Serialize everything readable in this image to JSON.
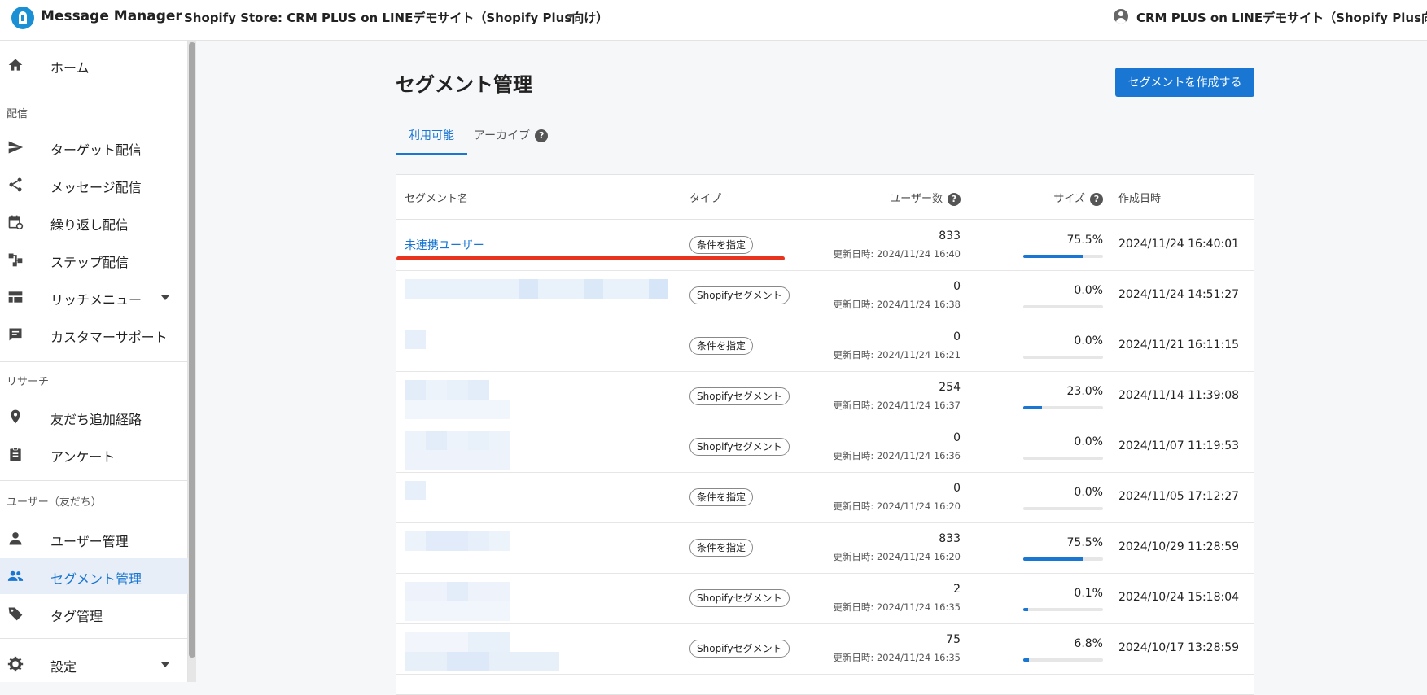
{
  "app": {
    "name": "Message Manager"
  },
  "header": {
    "store_label": "Shopify Store: CRM PLUS on LINEデモサイト（Shopify Plus向け）",
    "user_name": "CRM PLUS on LINEデモサイト（Shopify Plus向け）"
  },
  "sidebar": {
    "home": "ホーム",
    "section_delivery": "配信",
    "target_delivery": "ターゲット配信",
    "message_delivery": "メッセージ配信",
    "repeat_delivery": "繰り返し配信",
    "step_delivery": "ステップ配信",
    "rich_menu": "リッチメニュー",
    "customer_support": "カスタマーサポート",
    "section_research": "リサーチ",
    "friend_route": "友だち追加経路",
    "survey": "アンケート",
    "section_users": "ユーザー（友だち）",
    "user_management": "ユーザー管理",
    "segment_management": "セグメント管理",
    "tag_management": "タグ管理",
    "settings": "設定"
  },
  "main": {
    "title": "セグメント管理",
    "create_button": "セグメントを作成する",
    "tab_available": "利用可能",
    "tab_archive": "アーカイブ",
    "help_glyph": "?"
  },
  "table": {
    "headers": {
      "name": "セグメント名",
      "type": "タイプ",
      "users": "ユーザー数",
      "size": "サイズ",
      "created": "作成日時"
    },
    "rows": [
      {
        "name": "未連携ユーザー",
        "type": "条件を指定",
        "users": "833",
        "updated": "更新日時: 2024/11/24 16:40",
        "size": "75.5%",
        "size_value": 75.5,
        "created": "2024/11/24 16:40:01"
      },
      {
        "name": "",
        "type": "Shopifyセグメント",
        "users": "0",
        "updated": "更新日時: 2024/11/24 16:38",
        "size": "0.0%",
        "size_value": 0.0,
        "created": "2024/11/24 14:51:27"
      },
      {
        "name": "",
        "type": "条件を指定",
        "users": "0",
        "updated": "更新日時: 2024/11/24 16:21",
        "size": "0.0%",
        "size_value": 0.0,
        "created": "2024/11/21 16:11:15"
      },
      {
        "name": "",
        "type": "Shopifyセグメント",
        "users": "254",
        "updated": "更新日時: 2024/11/24 16:37",
        "size": "23.0%",
        "size_value": 23.0,
        "created": "2024/11/14 11:39:08"
      },
      {
        "name": "",
        "type": "Shopifyセグメント",
        "users": "0",
        "updated": "更新日時: 2024/11/24 16:36",
        "size": "0.0%",
        "size_value": 0.0,
        "created": "2024/11/07 11:19:53"
      },
      {
        "name": "",
        "type": "条件を指定",
        "users": "0",
        "updated": "更新日時: 2024/11/24 16:20",
        "size": "0.0%",
        "size_value": 0.0,
        "created": "2024/11/05 17:12:27"
      },
      {
        "name": "",
        "type": "条件を指定",
        "users": "833",
        "updated": "更新日時: 2024/11/24 16:20",
        "size": "75.5%",
        "size_value": 75.5,
        "created": "2024/10/29 11:28:59"
      },
      {
        "name": "",
        "type": "Shopifyセグメント",
        "users": "2",
        "updated": "更新日時: 2024/11/24 16:35",
        "size": "0.1%",
        "size_value": 0.1,
        "created": "2024/10/24 15:18:04"
      },
      {
        "name": "",
        "type": "Shopifyセグメント",
        "users": "75",
        "updated": "更新日時: 2024/11/24 16:35",
        "size": "6.8%",
        "size_value": 6.8,
        "created": "2024/10/17 13:28:59"
      }
    ]
  },
  "colors": {
    "accent": "#1976d2",
    "highlight": "#e8331f"
  }
}
